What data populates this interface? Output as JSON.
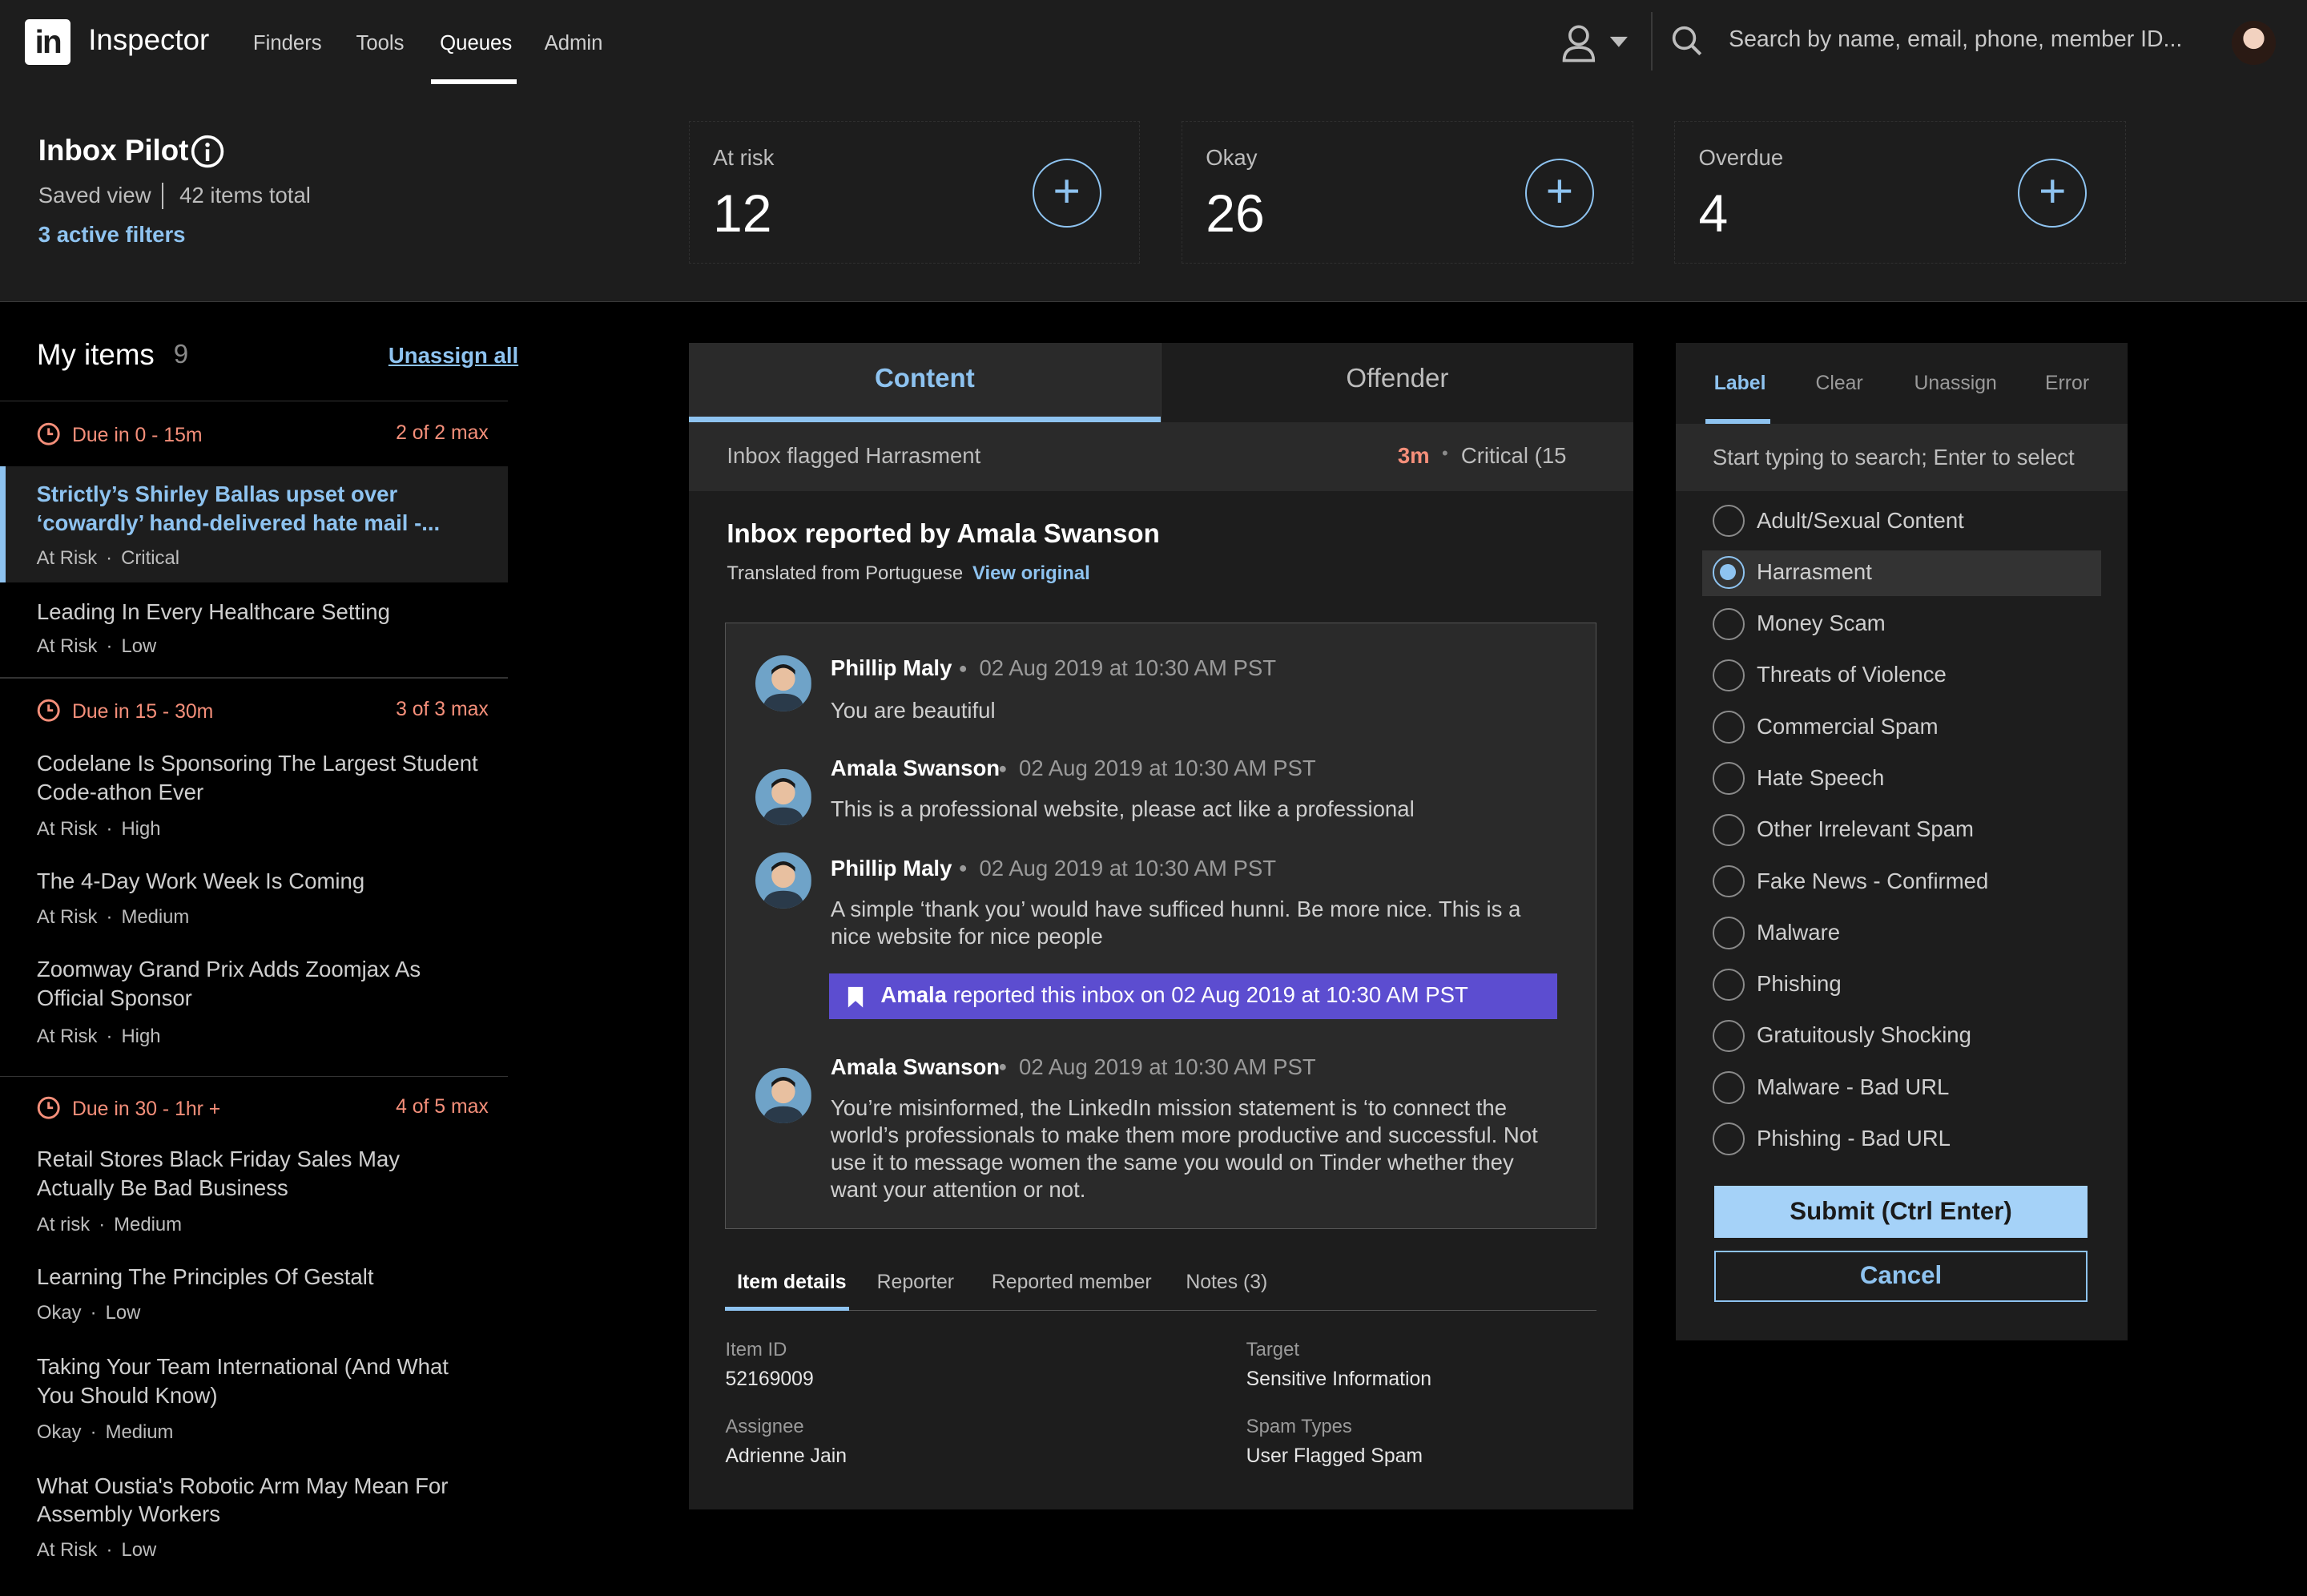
{
  "nav": {
    "logo": "in",
    "app_name": "Inspector",
    "links": [
      "Finders",
      "Tools",
      "Queues",
      "Admin"
    ],
    "active": "Queues",
    "search_placeholder": "Search by name, email, phone, member ID..."
  },
  "header": {
    "title": "Inbox Pilot",
    "saved_view": "Saved view",
    "total": "42 items total",
    "filters": "3 active filters",
    "stats": [
      {
        "label": "At risk",
        "value": "12"
      },
      {
        "label": "Okay",
        "value": "26"
      },
      {
        "label": "Overdue",
        "value": "4"
      }
    ]
  },
  "sidebar": {
    "title": "My items",
    "count": "9",
    "unassign": "Unassign all",
    "groups": [
      {
        "due": "Due in 0 - 15m",
        "max": "2 of 2 max",
        "items": [
          {
            "title": "Strictly’s Shirley Ballas upset over ‘cowardly’ hand-delivered hate mail -...",
            "status": "At Risk",
            "severity": "Critical",
            "selected": true
          },
          {
            "title": "Leading In Every Healthcare Setting",
            "status": "At Risk",
            "severity": "Low"
          }
        ]
      },
      {
        "due": "Due in 15 - 30m",
        "max": "3 of 3 max",
        "items": [
          {
            "title": "Codelane Is Sponsoring The Largest Student Code-athon Ever",
            "status": "At Risk",
            "severity": "High"
          },
          {
            "title": "The 4-Day Work Week Is Coming",
            "status": "At Risk",
            "severity": "Medium"
          },
          {
            "title": "Zoomway Grand Prix Adds Zoomjax As Official Sponsor",
            "status": "At Risk",
            "severity": "High"
          }
        ]
      },
      {
        "due": "Due in 30 - 1hr +",
        "max": "4 of 5 max",
        "items": [
          {
            "title": "Retail Stores Black Friday Sales May Actually Be Bad Business",
            "status": "At risk",
            "severity": "Medium"
          },
          {
            "title": "Learning The Principles Of Gestalt",
            "status": "Okay",
            "severity": "Low"
          },
          {
            "title": "Taking Your Team International (And What You Should Know)",
            "status": "Okay",
            "severity": "Medium"
          },
          {
            "title": "What Oustia's Robotic Arm May Mean For Assembly Workers",
            "status": "At Risk",
            "severity": "Low"
          }
        ]
      }
    ]
  },
  "center": {
    "tabs": [
      "Content",
      "Offender"
    ],
    "flag_text": "Inbox flagged Harrasment",
    "flag_time": "3m",
    "flag_severity": "Critical (15",
    "reported_by": "Inbox reported by Amala Swanson",
    "translated": "Translated from Portuguese",
    "view_original": "View original",
    "messages": [
      {
        "name": "Phillip Maly",
        "date": "02 Aug 2019 at 10:30 AM PST",
        "body": "You are beautiful"
      },
      {
        "name": "Amala Swanson",
        "date": "02 Aug 2019 at 10:30 AM PST",
        "body": "This is a professional website, please act like a professional"
      },
      {
        "name": "Phillip Maly",
        "date": "02 Aug 2019 at 10:30 AM PST",
        "body": "A simple ‘thank you’ would have sufficed hunni. Be more nice. This is a nice website for nice people"
      },
      {
        "name": "Amala Swanson",
        "date": "02 Aug 2019 at 10:30 AM PST",
        "body": "You’re misinformed, the LinkedIn mission statement is ‘to connect the world’s professionals to make them more productive and successful. Not use it to message women the same you would on Tinder whether they want your attention or not."
      }
    ],
    "report_banner": {
      "name": "Amala",
      "text": " reported this inbox on 02 Aug 2019 at 10:30 AM PST"
    },
    "subtabs": [
      "Item details",
      "Reporter",
      "Reported member",
      "Notes (3)"
    ],
    "details": {
      "item_id_label": "Item ID",
      "item_id": "52169009",
      "target_label": "Target",
      "target": "Sensitive Information",
      "assignee_label": "Assignee",
      "assignee": "Adrienne Jain",
      "spam_types_label": "Spam Types",
      "spam_types": "User Flagged Spam"
    }
  },
  "right": {
    "tabs": [
      "Label",
      "Clear",
      "Unassign",
      "Error"
    ],
    "search_placeholder": "Start typing to search; Enter to select",
    "options": [
      "Adult/Sexual Content",
      "Harrasment",
      "Money Scam",
      "Threats of Violence",
      "Commercial Spam",
      "Hate Speech",
      "Other Irrelevant Spam",
      "Fake News - Confirmed",
      "Malware",
      "Phishing",
      "Gratuitously Shocking",
      "Malware - Bad URL",
      "Phishing - Bad URL"
    ],
    "selected": "Harrasment",
    "submit": "Submit (Ctrl Enter)",
    "cancel": "Cancel"
  },
  "colors": {
    "accent": "#8ec3f0",
    "danger": "#f58f7a",
    "banner": "#5c4dd0",
    "panel": "#1d1d1d"
  }
}
